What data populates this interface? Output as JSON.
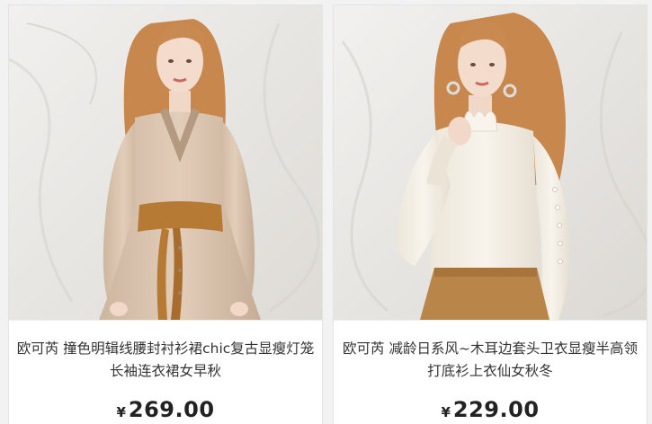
{
  "products": [
    {
      "title": "欧可芮 撞色明辑线腰封衬衫裙chic复古显瘦灯笼长袖连衣裙女早秋",
      "currency": "¥",
      "price": "269.00",
      "image_icon": "product-photo-dress"
    },
    {
      "title": "欧可芮 减龄日系风~木耳边套头卫衣显瘦半高领打底衫上衣仙女秋冬",
      "currency": "¥",
      "price": "229.00",
      "image_icon": "product-photo-blouse"
    }
  ],
  "colors": {
    "price": "#222222",
    "title": "#333333",
    "card_bg": "#ffffff",
    "page_bg": "#f2f2f2"
  }
}
